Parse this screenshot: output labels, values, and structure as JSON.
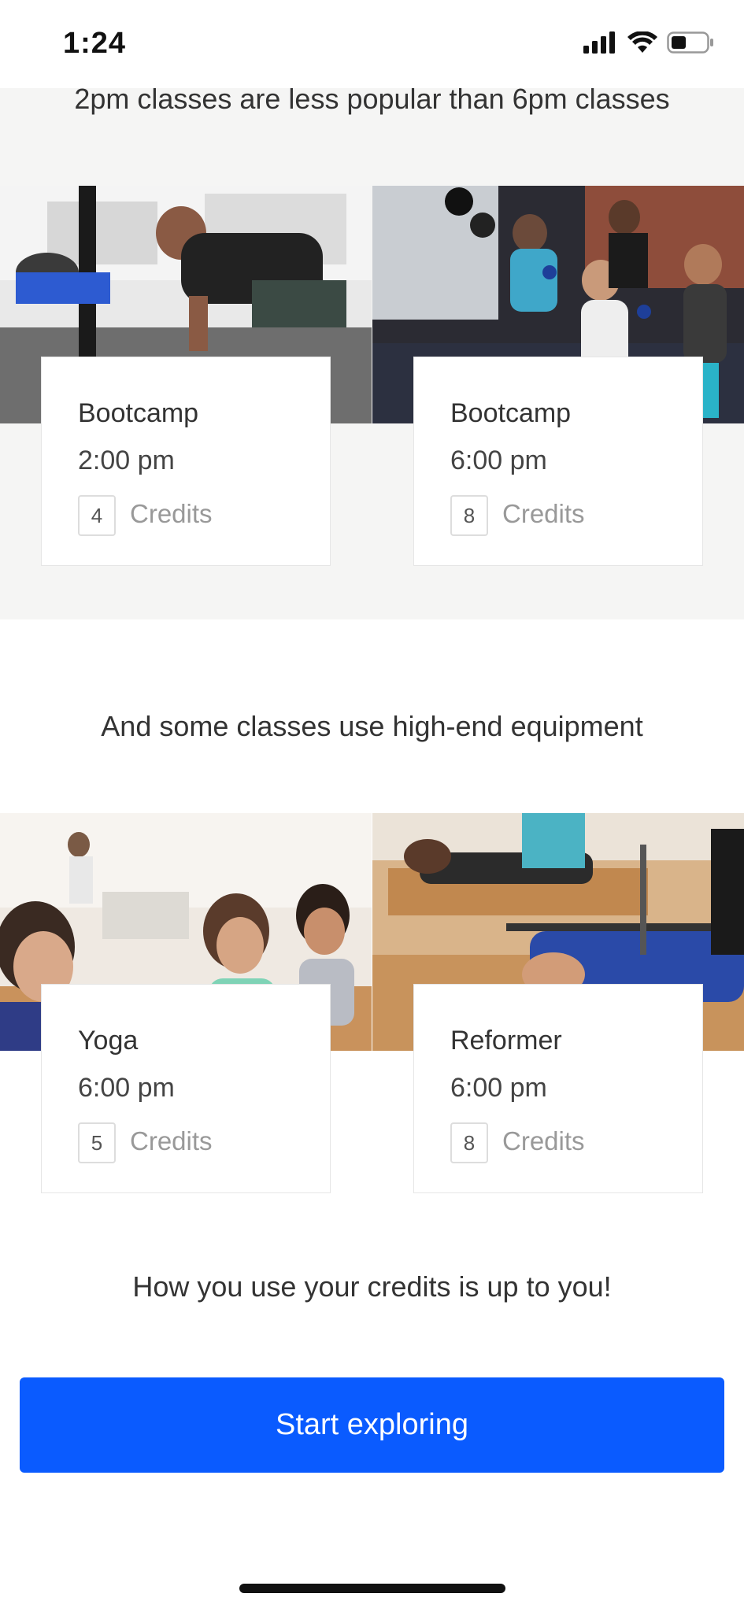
{
  "status_bar": {
    "time": "1:24"
  },
  "sections": [
    {
      "title": "2pm classes are less popular than 6pm classes"
    },
    {
      "title": "And some classes use high-end equipment"
    }
  ],
  "classes": [
    {
      "name": "Bootcamp",
      "time": "2:00 pm",
      "credits": "4",
      "credits_label": "Credits"
    },
    {
      "name": "Bootcamp",
      "time": "6:00 pm",
      "credits": "8",
      "credits_label": "Credits"
    },
    {
      "name": "Yoga",
      "time": "6:00 pm",
      "credits": "5",
      "credits_label": "Credits"
    },
    {
      "name": "Reformer",
      "time": "6:00 pm",
      "credits": "8",
      "credits_label": "Credits"
    }
  ],
  "footer": {
    "message": "How you use your credits is up to you!"
  },
  "cta": {
    "label": "Start exploring"
  },
  "colors": {
    "accent": "#0a5bff",
    "gray_bg": "#f5f5f4"
  }
}
